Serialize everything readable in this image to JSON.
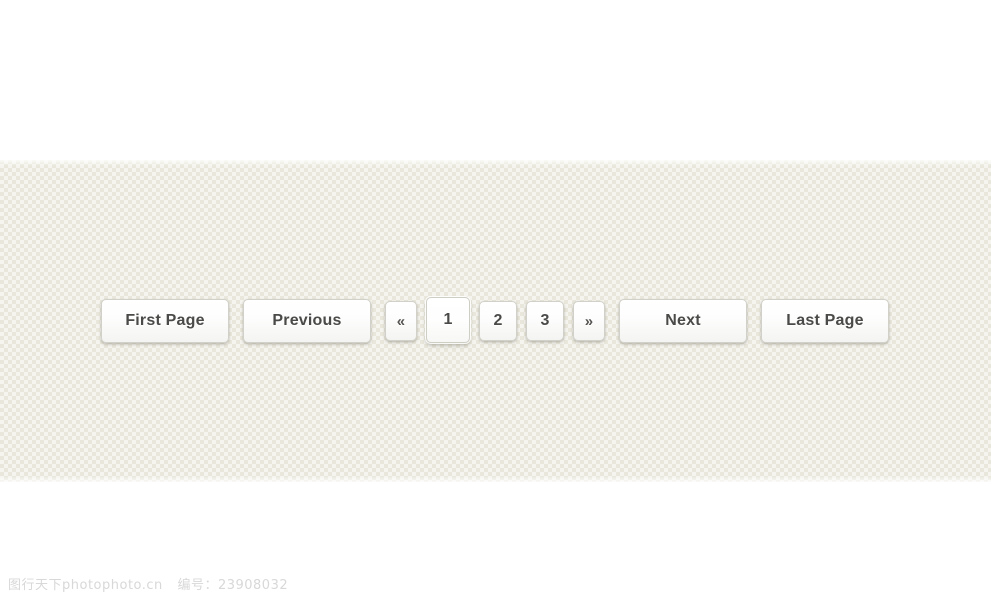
{
  "background": {
    "page_color": "#ffffff",
    "panel_color": "#eceade",
    "button_text_color": "#4a4a48",
    "button_border_color": "#d2d1c9"
  },
  "pagination": {
    "first_page_label": "First Page",
    "previous_label": "Previous",
    "prev_arrow_label": "«",
    "pages": [
      {
        "label": "1",
        "active": true
      },
      {
        "label": "2",
        "active": false
      },
      {
        "label": "3",
        "active": false
      }
    ],
    "next_arrow_label": "»",
    "next_label": "Next",
    "last_page_label": "Last Page",
    "current_page": "1"
  },
  "watermark": {
    "site": "图行天下photophoto.cn",
    "id_label": "编号：23908032"
  }
}
